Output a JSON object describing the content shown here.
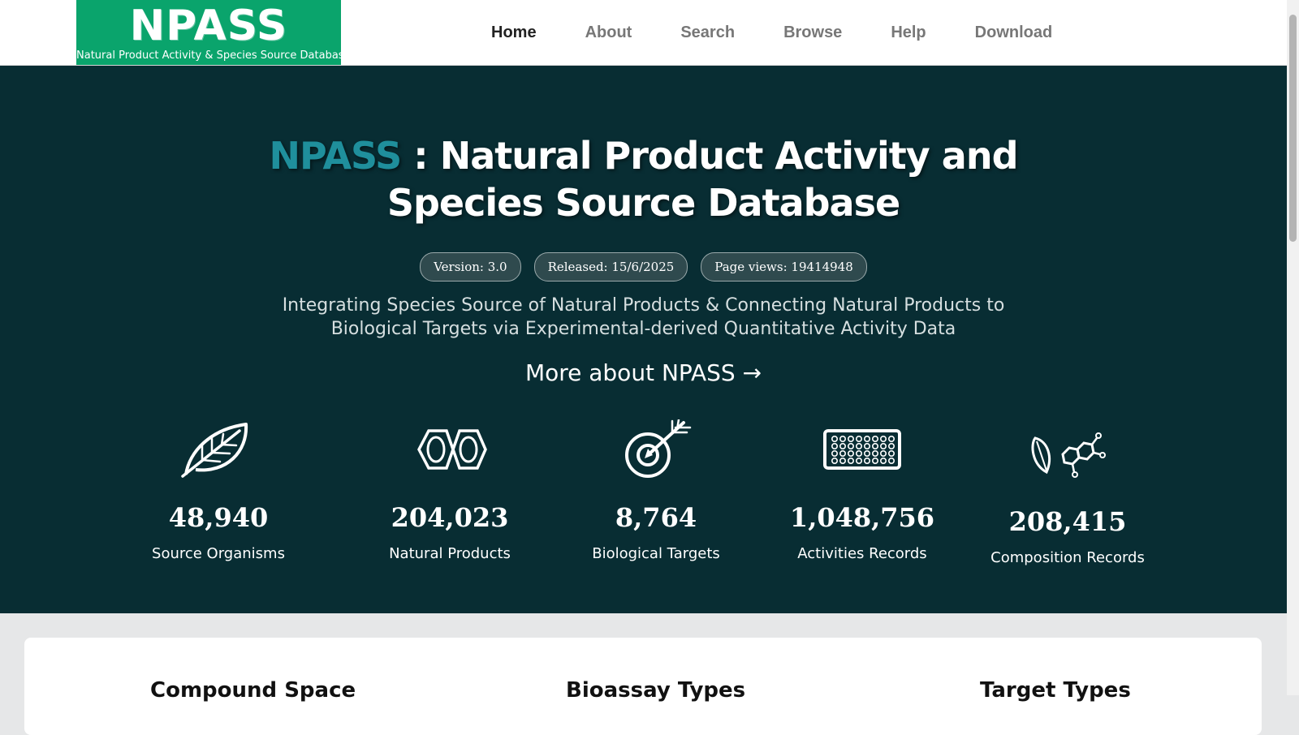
{
  "logo": {
    "title": "NPASS",
    "subtitle": "Natural Product Activity & Species Source Database"
  },
  "nav": {
    "items": [
      {
        "label": "Home",
        "active": true
      },
      {
        "label": "About",
        "active": false
      },
      {
        "label": "Search",
        "active": false
      },
      {
        "label": "Browse",
        "active": false
      },
      {
        "label": "Help",
        "active": false
      },
      {
        "label": "Download",
        "active": false
      }
    ]
  },
  "hero": {
    "title_brand": "NPASS",
    "title_rest": " : Natural Product Activity and Species Source Database",
    "badges": [
      "Version: 3.0",
      "Released: 15/6/2025",
      "Page views: 19414948"
    ],
    "description": "Integrating Species Source of Natural Products & Connecting Natural Products to Biological Targets via Experimental-derived Quantitative Activity Data",
    "more_link": "More about NPASS →"
  },
  "stats": [
    {
      "value": "48,940",
      "label": "Source Organisms",
      "icon": "leaf-icon"
    },
    {
      "value": "204,023",
      "label": "Natural Products",
      "icon": "molecule-rings-icon"
    },
    {
      "value": "8,764",
      "label": "Biological Targets",
      "icon": "target-icon"
    },
    {
      "value": "1,048,756",
      "label": "Activities Records",
      "icon": "assay-plate-icon"
    },
    {
      "value": "208,415",
      "label": "Composition Records",
      "icon": "leaf-molecule-icon"
    }
  ],
  "sections": [
    "Compound Space",
    "Bioassay Types",
    "Target Types"
  ],
  "colors": {
    "logo_bg": "#0aa46c",
    "hero_bg": "#082d33",
    "brand_accent": "#1f8f9c",
    "page_bg": "#e6e7e8"
  }
}
